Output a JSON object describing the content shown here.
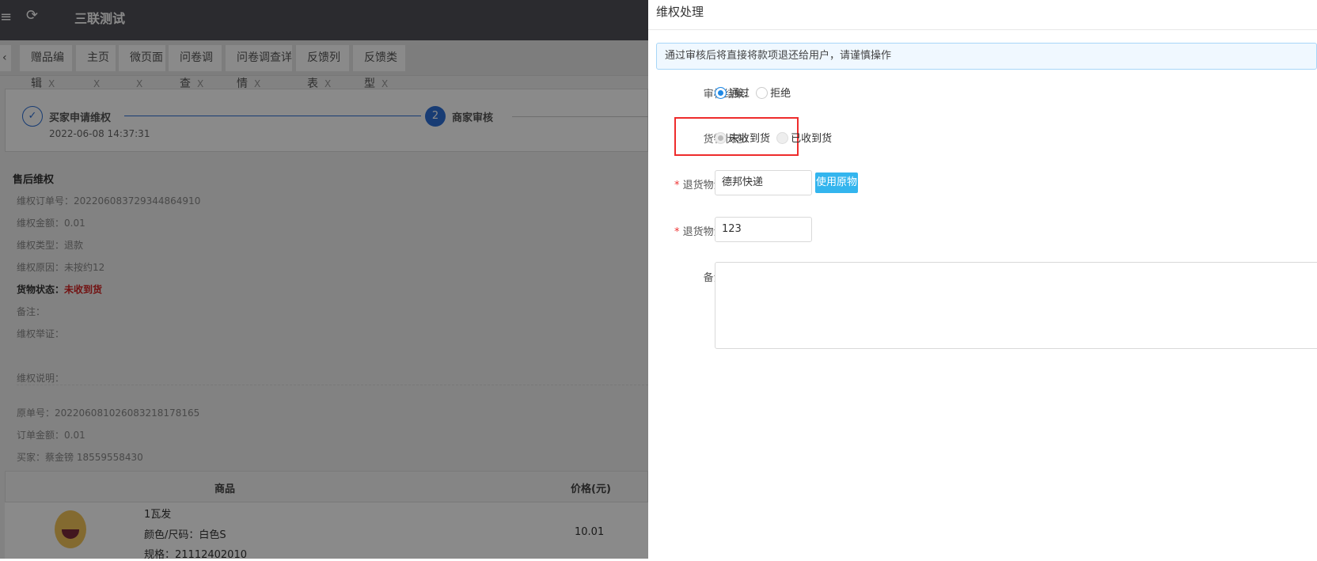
{
  "header": {
    "title": "三联测试",
    "menu_icon": "menu-icon",
    "refresh_icon": "refresh-icon"
  },
  "tabs": [
    {
      "label": "赠品编辑"
    },
    {
      "label": "主页"
    },
    {
      "label": "微页面"
    },
    {
      "label": "问卷调查"
    },
    {
      "label": "问卷调查详情"
    },
    {
      "label": "反馈列表"
    },
    {
      "label": "反馈类型"
    }
  ],
  "tab_close": "X",
  "steps": [
    {
      "label": "买家申请维权",
      "time": "2022-06-08 14:37:31",
      "status": "done"
    },
    {
      "label": "商家审核",
      "number": "2",
      "status": "active"
    }
  ],
  "detail": {
    "section_title": "售后维权",
    "order_no": "维权订单号：2022060837293448649​10",
    "amount": "维权金额：0.01",
    "type": "维权类型：退款",
    "reason": "维权原因：未按约12",
    "goods_status_label": "货物状态：",
    "goods_status_value": "未收到货",
    "remark": "备注：",
    "evidence": "维权举证：",
    "explain": "维权说明：",
    "orig_no": "原单号：20220608102608321817816​5",
    "order_amount": "订单金额：0.01",
    "buyer": "买家：蔡金镑  18559558430"
  },
  "table": {
    "headers": [
      "商品",
      "价格(元)"
    ],
    "rows": [
      {
        "name": "1瓦发",
        "spec1": "颜色/尺码：白色S",
        "spec2": "规格：21112402010",
        "price": "10.01"
      }
    ]
  },
  "drawer": {
    "title": "维权处理",
    "alert": "通过审核后将直接将款项退还给用户，请谨慎操作",
    "review_label": "审核结果:",
    "review_options": [
      "通过",
      "拒绝"
    ],
    "review_selected": "通过",
    "goods_label": "货物状态:",
    "goods_options": [
      "未收到货",
      "已收到货"
    ],
    "goods_selected": "未收到货",
    "company_label": "退货物流公司:",
    "company_value": "德邦快递",
    "use_orig_button": "使用原物流",
    "tracking_label": "退货物流单号:",
    "tracking_value": "123",
    "remark_label": "备注信息:",
    "remark_value": "",
    "required_mark": "*",
    "accent": "#1e88e5",
    "highlight": "#ee2c2c"
  }
}
